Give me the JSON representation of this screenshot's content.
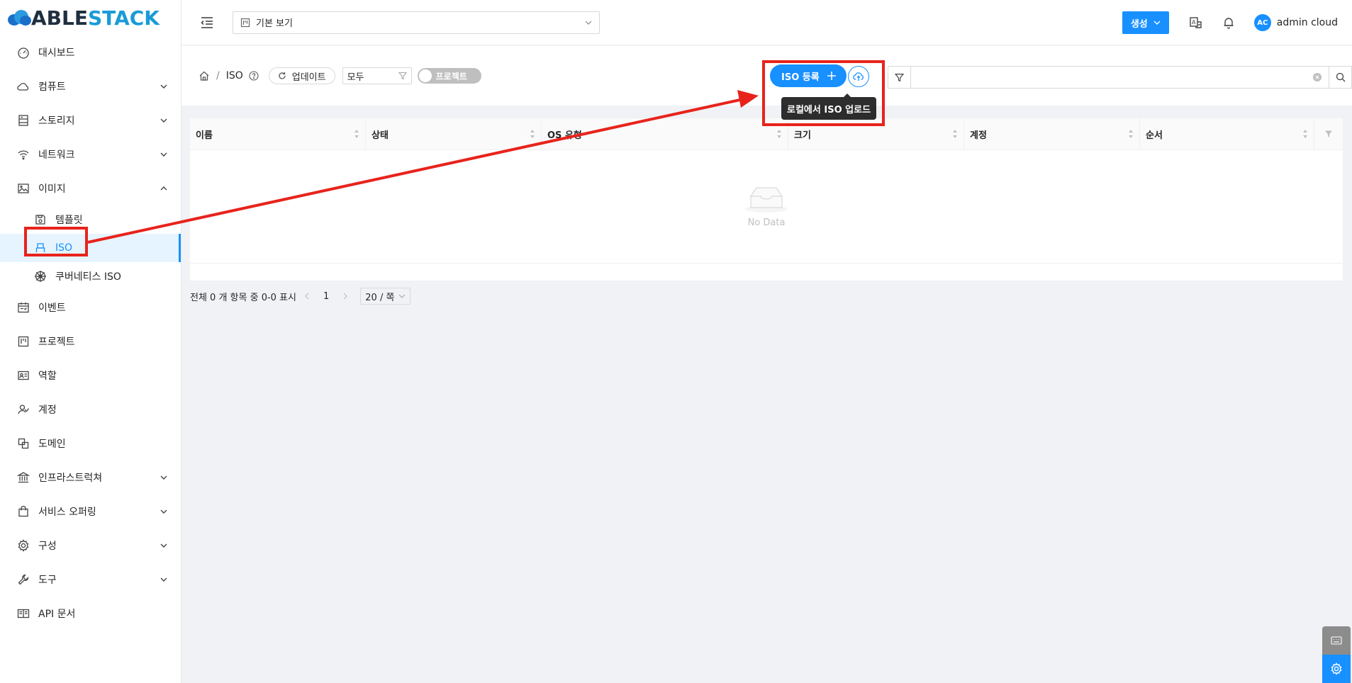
{
  "logo": {
    "part1": "ABLE",
    "part2": "STACK"
  },
  "sidebar": {
    "items": [
      {
        "label": "대시보드",
        "icon": "dashboard-icon",
        "arrow": ""
      },
      {
        "label": "컴퓨트",
        "icon": "cloud-icon",
        "arrow": "down"
      },
      {
        "label": "스토리지",
        "icon": "storage-icon",
        "arrow": "down"
      },
      {
        "label": "네트워크",
        "icon": "wifi-icon",
        "arrow": "down"
      },
      {
        "label": "이미지",
        "icon": "picture-icon",
        "arrow": "up"
      },
      {
        "label": "템플릿",
        "icon": "save-icon",
        "arrow": "",
        "sub": true
      },
      {
        "label": "ISO",
        "icon": "usb-icon",
        "arrow": "",
        "sub": true,
        "active": true
      },
      {
        "label": "쿠버네티스 ISO",
        "icon": "helm-icon",
        "arrow": "",
        "sub": true
      },
      {
        "label": "이벤트",
        "icon": "schedule-icon",
        "arrow": ""
      },
      {
        "label": "프로젝트",
        "icon": "project-icon",
        "arrow": ""
      },
      {
        "label": "역할",
        "icon": "idcard-icon",
        "arrow": ""
      },
      {
        "label": "계정",
        "icon": "team-icon",
        "arrow": ""
      },
      {
        "label": "도메인",
        "icon": "block-icon",
        "arrow": ""
      },
      {
        "label": "인프라스트럭쳐",
        "icon": "bank-icon",
        "arrow": "down"
      },
      {
        "label": "서비스 오퍼링",
        "icon": "shopping-icon",
        "arrow": "down"
      },
      {
        "label": "구성",
        "icon": "setting-icon",
        "arrow": "down"
      },
      {
        "label": "도구",
        "icon": "tool-icon",
        "arrow": "down"
      },
      {
        "label": "API 문서",
        "icon": "read-icon",
        "arrow": ""
      }
    ]
  },
  "header": {
    "view_select": "기본 보기",
    "create_label": "생성",
    "user_initials": "AC",
    "username": "admin cloud"
  },
  "toolbar": {
    "crumb_sep": "/",
    "crumb_current": "ISO",
    "update_label": "업데이트",
    "filter_value": "모두",
    "project_toggle": "프로젝트",
    "iso_register": "ISO 등록",
    "upload_tooltip": "로컬에서 ISO 업로드",
    "search_value": ""
  },
  "table": {
    "columns": [
      "이름",
      "상태",
      "OS 유형",
      "크기",
      "계정",
      "순서"
    ],
    "empty_text": "No Data"
  },
  "pager": {
    "summary": "전체 0 개 항목 중 0-0 표시",
    "page": "1",
    "page_size": "20 / 쪽"
  },
  "colors": {
    "accent": "#1890ff",
    "annotation": "#e8231c"
  }
}
